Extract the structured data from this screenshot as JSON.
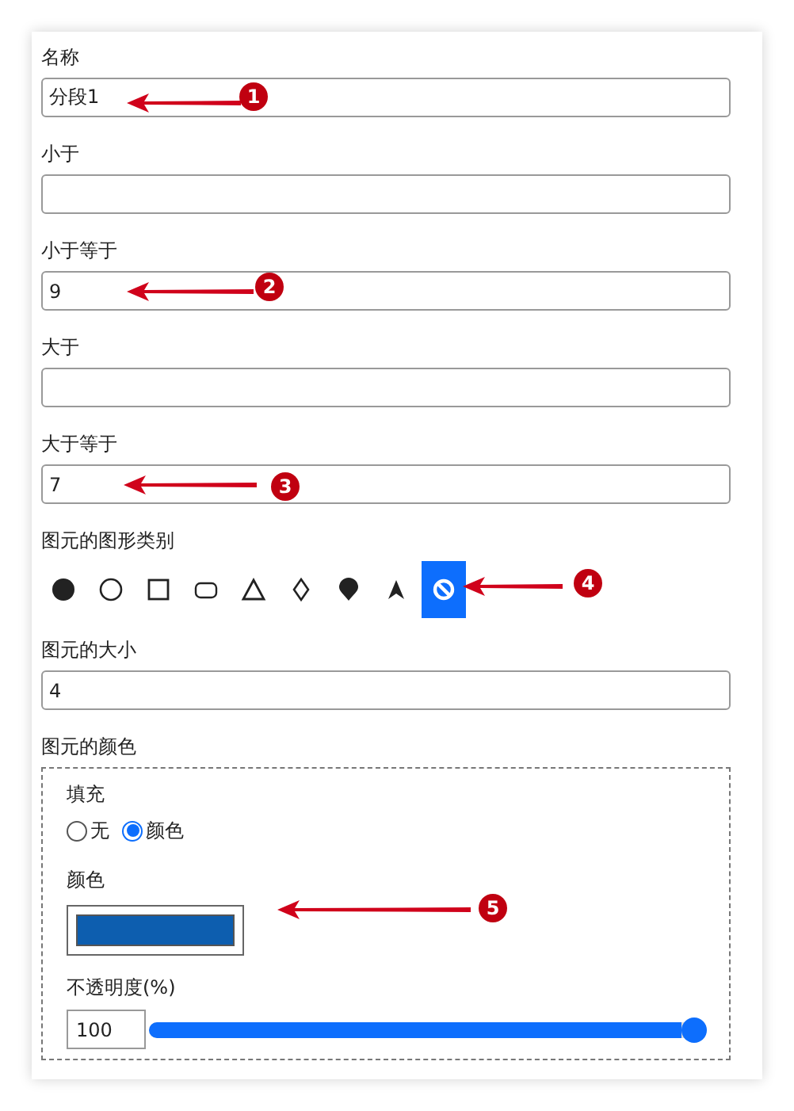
{
  "fields": [
    {
      "label": "名称",
      "value": "分段1"
    },
    {
      "label": "小于"
    },
    {
      "label": "小于等于",
      "value": "9"
    },
    {
      "label": "大于"
    },
    {
      "label": "大于等于",
      "value": "7"
    }
  ],
  "symbol_type": {
    "label": "图元的图形类别",
    "options": [
      {
        "kind": "circle",
        "selected": false
      },
      {
        "kind": "ring",
        "selected": false
      },
      {
        "kind": "square",
        "selected": false
      },
      {
        "kind": "rounded",
        "selected": false
      },
      {
        "kind": "triangle",
        "selected": false
      },
      {
        "kind": "diamond",
        "selected": false
      },
      {
        "kind": "pin",
        "selected": false
      },
      {
        "kind": "arrow",
        "selected": false
      },
      {
        "kind": "none",
        "selected": true
      }
    ]
  },
  "symbol_size": {
    "label": "图元的大小",
    "value": "4"
  },
  "symbol_color": {
    "label": "图元的颜色",
    "fill_label": "填充",
    "fill_options": [
      {
        "label": "无",
        "selected": false
      },
      {
        "label": "颜色",
        "selected": true
      }
    ],
    "color_label": "颜色",
    "color": "#0d5eaf",
    "opacity_label": "不透明度(%)",
    "opacity_value": "100",
    "opacity": {
      "level": 1
    }
  },
  "annotations": [
    {
      "number": "1"
    },
    {
      "number": "2"
    },
    {
      "number": "3"
    },
    {
      "number": "4"
    },
    {
      "number": "5"
    }
  ]
}
